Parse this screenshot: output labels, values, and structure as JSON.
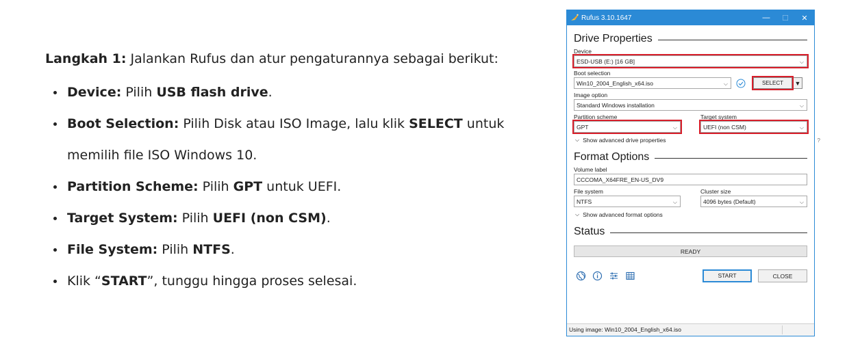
{
  "instructions": {
    "intro_bold": "Langkah 1:",
    "intro_text": " Jalankan Rufus dan atur pengaturannya sebagai berikut:",
    "steps": [
      {
        "parts": [
          {
            "b": "Device:"
          },
          {
            "t": " Pilih "
          },
          {
            "b": "USB flash drive"
          },
          {
            "t": "."
          }
        ]
      },
      {
        "parts": [
          {
            "b": "Boot Selection:"
          },
          {
            "t": " Pilih Disk atau ISO Image, lalu klik "
          },
          {
            "b": "SELECT"
          },
          {
            "t": " untuk"
          }
        ]
      },
      {
        "parts": [
          {
            "t": "memilih file ISO Windows 10."
          }
        ],
        "nobullet": true
      },
      {
        "parts": [
          {
            "b": "Partition Scheme:"
          },
          {
            "t": " Pilih "
          },
          {
            "b": "GPT"
          },
          {
            "t": " untuk UEFI."
          }
        ]
      },
      {
        "parts": [
          {
            "b": "Target System:"
          },
          {
            "t": " Pilih "
          },
          {
            "b": "UEFI (non CSM)"
          },
          {
            "t": "."
          }
        ]
      },
      {
        "parts": [
          {
            "b": "File System:"
          },
          {
            "t": " Pilih "
          },
          {
            "b": "NTFS"
          },
          {
            "t": "."
          }
        ]
      },
      {
        "parts": [
          {
            "t": "Klik “"
          },
          {
            "b": "START"
          },
          {
            "t": "”, tunggu hingga proses selesai."
          }
        ]
      }
    ]
  },
  "window": {
    "title": "Rufus 3.10.1647",
    "controls": {
      "minimize": "—",
      "maximize": "☐",
      "close": "✕"
    },
    "accent_color": "#2b8ad6",
    "highlight_color": "#d81e2a",
    "drive_properties": {
      "heading": "Drive Properties",
      "device_label": "Device",
      "device_value": "ESD-USB (E:) [16 GB]",
      "boot_label": "Boot selection",
      "boot_value": "Win10_2004_English_x64.iso",
      "select_button": "SELECT",
      "image_option_label": "Image option",
      "image_option_value": "Standard Windows installation",
      "partition_label": "Partition scheme",
      "partition_value": "GPT",
      "target_label": "Target system",
      "target_value": "UEFI (non CSM)",
      "target_help": "?",
      "advanced_toggle": "Show advanced drive properties"
    },
    "format_options": {
      "heading": "Format Options",
      "volume_label": "Volume label",
      "volume_value": "CCCOMA_X64FRE_EN-US_DV9",
      "fs_label": "File system",
      "fs_value": "NTFS",
      "cluster_label": "Cluster size",
      "cluster_value": "4096 bytes (Default)",
      "advanced_toggle": "Show advanced format options"
    },
    "status": {
      "heading": "Status",
      "progress_text": "READY"
    },
    "buttons": {
      "start": "START",
      "close": "CLOSE"
    },
    "bottom_icons": [
      "globe-icon",
      "info-icon",
      "settings-sliders-icon",
      "log-table-icon"
    ],
    "statusbar_text": "Using image: Win10_2004_English_x64.iso"
  }
}
